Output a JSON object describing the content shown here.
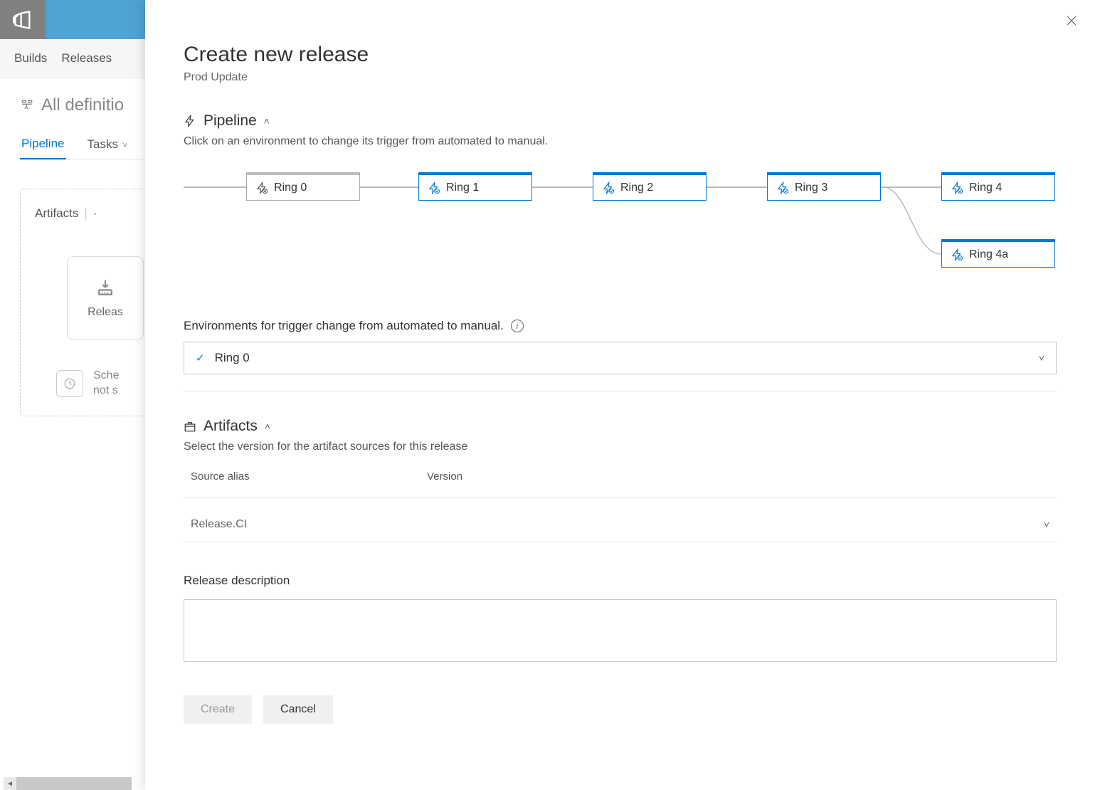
{
  "bg": {
    "subnav": {
      "builds": "Builds",
      "releases": "Releases"
    },
    "breadcrumb": "All definitio",
    "tabs": {
      "pipeline": "Pipeline",
      "tasks": "Tasks"
    },
    "artifacts_title": "Artifacts",
    "card_label": "Releas",
    "schedule": {
      "line1": "Sche",
      "line2": "not s"
    }
  },
  "panel": {
    "title": "Create new release",
    "subtitle": "Prod Update",
    "pipeline": {
      "header": "Pipeline",
      "hint": "Click on an environment to change its trigger from automated to manual.",
      "stages": [
        "Ring 0",
        "Ring 1",
        "Ring 2",
        "Ring 3",
        "Ring 4",
        "Ring 4a"
      ]
    },
    "envs": {
      "label": "Environments for trigger change from automated to manual.",
      "selected": "Ring 0"
    },
    "artifacts": {
      "header": "Artifacts",
      "hint": "Select the version for the artifact sources for this release",
      "col_alias": "Source alias",
      "col_version": "Version",
      "row_alias": "Release.CI"
    },
    "description_label": "Release description",
    "buttons": {
      "create": "Create",
      "cancel": "Cancel"
    }
  }
}
